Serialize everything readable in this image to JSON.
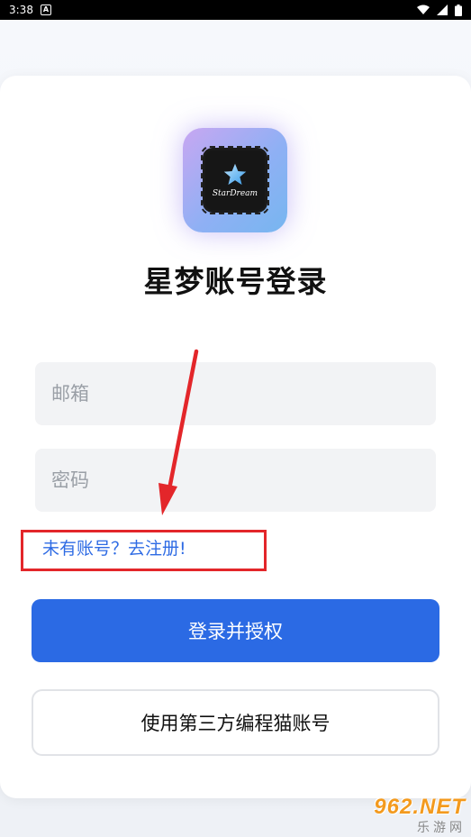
{
  "status_bar": {
    "time": "3:38",
    "notification_badge": "A"
  },
  "logo": {
    "text": "StarDream"
  },
  "title": "星梦账号登录",
  "email": {
    "placeholder": "邮箱",
    "value": ""
  },
  "password": {
    "placeholder": "密码",
    "value": ""
  },
  "register_link": "未有账号？去注册!",
  "login_button": "登录并授权",
  "third_party_button": "使用第三方编程猫账号",
  "watermark": {
    "top": "962.NET",
    "bottom": "乐游网"
  },
  "colors": {
    "primary": "#2b6ae4",
    "link": "#2e6be4",
    "annotation": "#e3262a",
    "input_bg": "#f2f3f5"
  }
}
